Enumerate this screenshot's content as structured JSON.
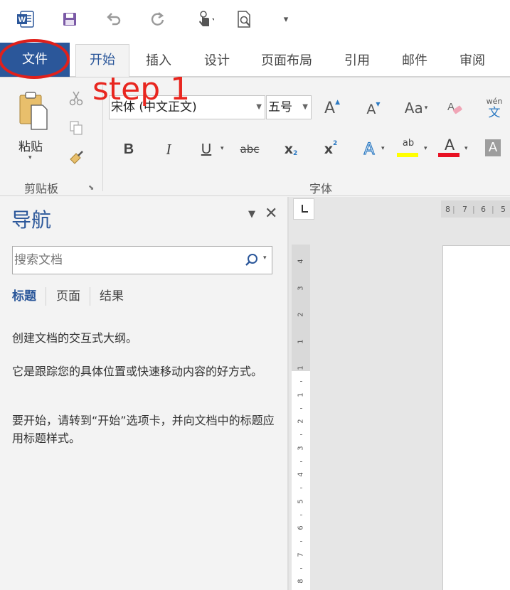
{
  "quick_access": {
    "word_icon_letter": "W",
    "customize_glyph": "▾"
  },
  "tabs": {
    "file": "文件",
    "home": "开始",
    "insert": "插入",
    "design": "设计",
    "layout": "页面布局",
    "references": "引用",
    "mailings": "邮件",
    "review": "审阅"
  },
  "annotation": {
    "text": "step 1",
    "color": "#e0201b"
  },
  "ribbon": {
    "clipboard": {
      "paste_label": "粘贴",
      "group_label": "剪贴板"
    },
    "font": {
      "font_name": "宋体 (中文正文)",
      "font_size": "五号",
      "group_label": "字体",
      "bold": "B",
      "italic": "I",
      "underline": "U",
      "strikethrough": "abc",
      "subscript": "x",
      "subscript_mark": "2",
      "superscript": "x",
      "superscript_mark": "2",
      "grow": "A",
      "shrink": "A",
      "change_case": "Aa",
      "phonetic_top": "wén",
      "phonetic_bottom": "文",
      "text_effects": "A",
      "highlight": "ab",
      "font_color": "A",
      "shading": "A",
      "highlight_color": "#ffff00",
      "font_color_value": "#e81123"
    }
  },
  "navigation": {
    "title": "导航",
    "search_placeholder": "搜索文档",
    "tabs": [
      "标题",
      "页面",
      "结果"
    ],
    "paragraphs": [
      "创建文档的交互式大纲。",
      "它是跟踪您的具体位置或快速移动内容的好方式。",
      "要开始，请转到“开始”选项卡，并向文档中的标题应用标题样式。"
    ]
  },
  "ruler": {
    "horizontal": [
      "8",
      "7",
      "6",
      "5"
    ],
    "vertical_top": [
      "4",
      "3",
      "2",
      "1"
    ],
    "vertical_bottom": [
      "1",
      "1",
      "2",
      "3",
      "4",
      "5",
      "6",
      "7",
      "8"
    ]
  },
  "colors": {
    "accent": "#2b579a"
  }
}
